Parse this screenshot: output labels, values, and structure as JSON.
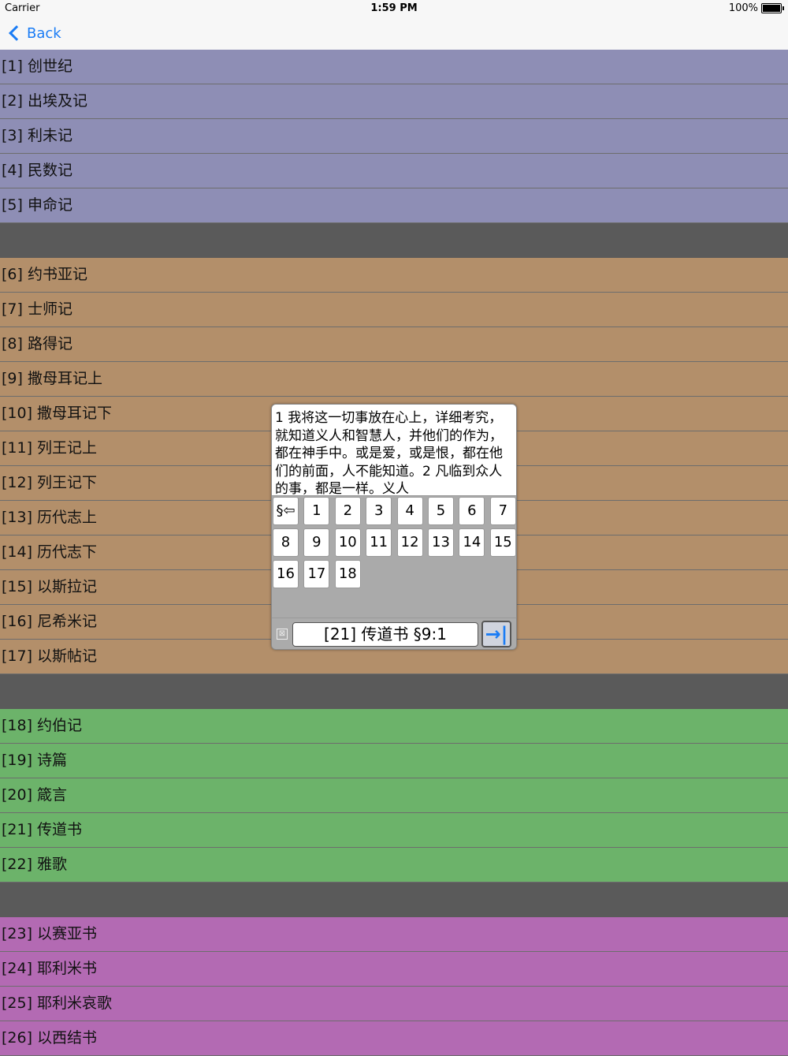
{
  "status": {
    "carrier": "Carrier",
    "time": "1:59 PM",
    "battery": "100%"
  },
  "nav": {
    "back_label": "Back"
  },
  "groups": [
    {
      "color": "#8e8eb5",
      "books": [
        "[1] 创世纪",
        "[2] 出埃及记",
        "[3] 利未记",
        "[4] 民数记",
        "[5] 申命记"
      ]
    },
    {
      "color": "#b38f6a",
      "books": [
        "[6] 约书亚记",
        "[7] 士师记",
        "[8] 路得记",
        "[9] 撒母耳记上",
        "[10] 撒母耳记下",
        "[11] 列王记上",
        "[12] 列王记下",
        "[13] 历代志上",
        "[14] 历代志下",
        "[15] 以斯拉记",
        "[16] 尼希米记",
        "[17] 以斯帖记"
      ]
    },
    {
      "color": "#6cb36a",
      "books": [
        "[18] 约伯记",
        "[19] 诗篇",
        "[20] 箴言",
        "[21] 传道书",
        "[22] 雅歌"
      ]
    },
    {
      "color": "#b36ab3",
      "books": [
        "[23] 以赛亚书",
        "[24] 耶利米书",
        "[25] 耶利米哀歌",
        "[26] 以西结书"
      ]
    }
  ],
  "popup": {
    "verse_text": "1 我将这一切事放在心上，详细考究，就知道义人和智慧人，并他们的作为，都在神手中。或是爱，或是恨，都在他们的前面，人不能知道。2 凡临到众人的事，都是一样。义人",
    "back_key": "§⇦",
    "chapter_keys": [
      "1",
      "2",
      "3",
      "4",
      "5",
      "6",
      "7",
      "8",
      "9",
      "10",
      "11",
      "12",
      "13",
      "14",
      "15",
      "16",
      "17",
      "18"
    ],
    "clear_icon": "⊠",
    "reference": "[21] 传道书 §9:1",
    "go_icon": "→|"
  }
}
